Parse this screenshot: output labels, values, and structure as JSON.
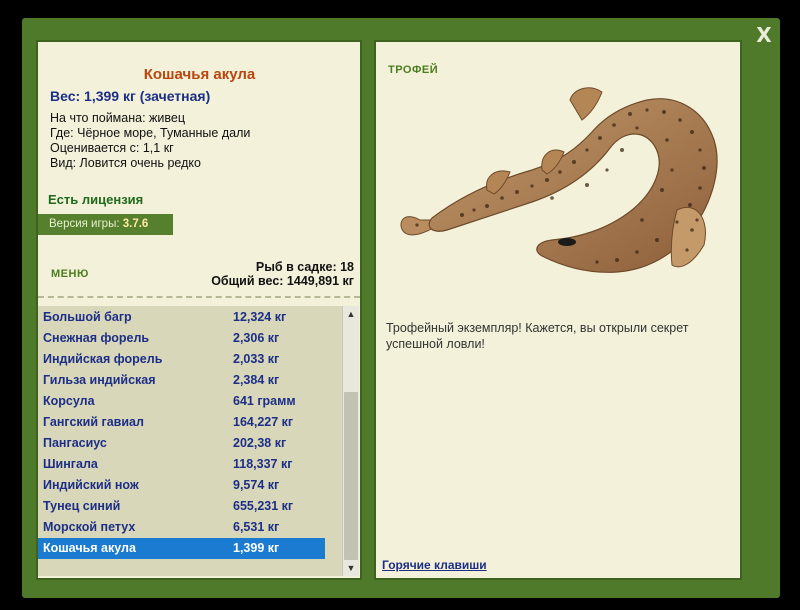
{
  "fish": {
    "title": "Кошачья акула",
    "weight": "Вес: 1,399 кг (зачетная)",
    "bait": "На что поймана: живец",
    "location": "Где: Чёрное море, Туманные дали",
    "value": "Оценивается с: 1,1 кг",
    "rarity": "Вид: Ловится очень редко"
  },
  "license": "Есть лицензия",
  "version": {
    "label": "Версия игры:",
    "value": "3.7.6"
  },
  "menu_label": "МЕНЮ",
  "stats": {
    "count": "Рыб в садке: 18",
    "total": "Общий вес: 1449,891 кг"
  },
  "catch_list": [
    {
      "name": "Большой багр",
      "weight": "12,324 кг"
    },
    {
      "name": "Снежная форель",
      "weight": "2,306 кг"
    },
    {
      "name": "Индийская форель",
      "weight": "2,033 кг"
    },
    {
      "name": "Гильза индийская",
      "weight": "2,384 кг"
    },
    {
      "name": "Корсула",
      "weight": "641 грамм"
    },
    {
      "name": "Гангский гавиал",
      "weight": "164,227 кг"
    },
    {
      "name": "Пангасиус",
      "weight": "202,38 кг"
    },
    {
      "name": "Шингала",
      "weight": "118,337 кг"
    },
    {
      "name": "Индийский нож",
      "weight": "9,574 кг"
    },
    {
      "name": "Тунец синий",
      "weight": "655,231 кг"
    },
    {
      "name": "Морской петух",
      "weight": "6,531 кг"
    },
    {
      "name": "Кошачья акула",
      "weight": "1,399 кг",
      "selected": true
    }
  ],
  "trophy_label": "ТРОФЕЙ",
  "trophy_text": "Трофейный экземпляр! Кажется, вы открыли секрет успешной ловли!",
  "hotkeys_link": "Горячие клавиши",
  "close_label": "X",
  "colors": {
    "frame": "#4f7a2a",
    "panel": "#f3f1da",
    "list_bg": "#d8d7ba",
    "selected": "#1a7bd1",
    "title": "#b8460e",
    "text_blue": "#1d2e86"
  }
}
